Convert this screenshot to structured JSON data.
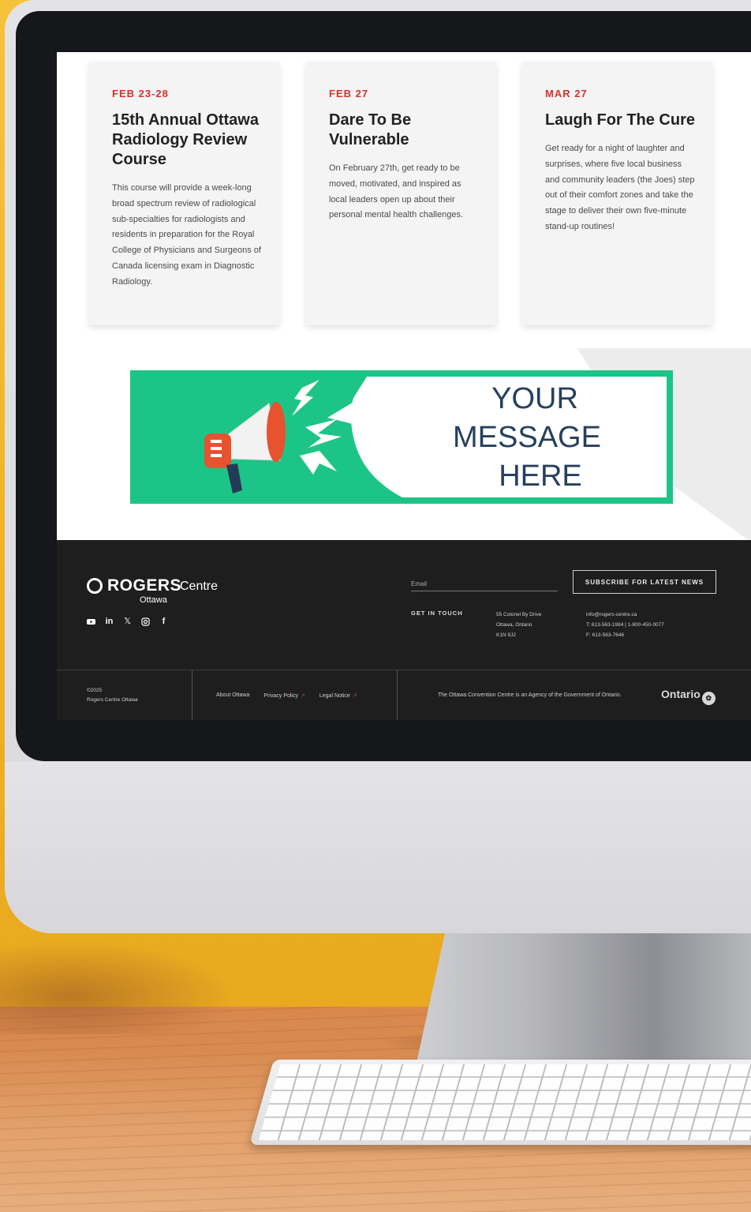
{
  "events": [
    {
      "date": "FEB 23-28",
      "title": "15th Annual Ottawa Radiology Review Course",
      "description": "This course will provide a week-long broad spectrum review of radiological sub-specialties for radiologists and residents in preparation for the Royal College of Physicians and Surgeons of Canada licensing exam in Diagnostic Radiology."
    },
    {
      "date": "FEB 27",
      "title": "Dare To Be Vulnerable",
      "description": "On February 27th, get ready to be moved, motivated, and inspired as local leaders open up about their personal mental health challenges."
    },
    {
      "date": "MAR 27",
      "title": "Laugh For The Cure",
      "description": "Get ready for a night of laughter and surprises, where five local business and community leaders (the Joes) step out of their comfort zones and take the stage to deliver their own five-minute stand-up routines!"
    }
  ],
  "banner": {
    "lines": [
      "YOUR",
      "MESSAGE",
      "HERE"
    ],
    "colors": {
      "background": "#1dc488",
      "bubble": "#ffffff",
      "text": "#26405e",
      "megaphone": "#e8522f"
    }
  },
  "footer": {
    "logo": {
      "brand": "ROGERS",
      "suffix": "Centre",
      "city": "Ottawa"
    },
    "socials": [
      "youtube-icon",
      "linkedin-icon",
      "x-icon",
      "instagram-icon",
      "facebook-icon"
    ],
    "email_placeholder": "Email",
    "subscribe_label": "SUBSCRIBE FOR LATEST NEWS",
    "get_in_touch": "GET IN TOUCH",
    "address": [
      "55 Colonel By Drive",
      "Ottawa, Ontario",
      "K1N 9J2"
    ],
    "contact": [
      "info@rogers-centre.ca",
      "T: 613-563-1984 | 1-800-450-0077",
      "F: 613-563-7646"
    ],
    "copyright": [
      "©2025",
      "Rogers Centre Ottawa"
    ],
    "links": [
      "About Ottawa",
      "Privacy Policy",
      "Legal Notice"
    ],
    "agency_text": "The Ottawa Convention Centre is an Agency of the Government of Ontario.",
    "ontario_label": "Ontario"
  },
  "colors": {
    "accent_red": "#d9302b",
    "footer_bg": "#1e1e1e",
    "card_bg": "#f4f4f4"
  }
}
